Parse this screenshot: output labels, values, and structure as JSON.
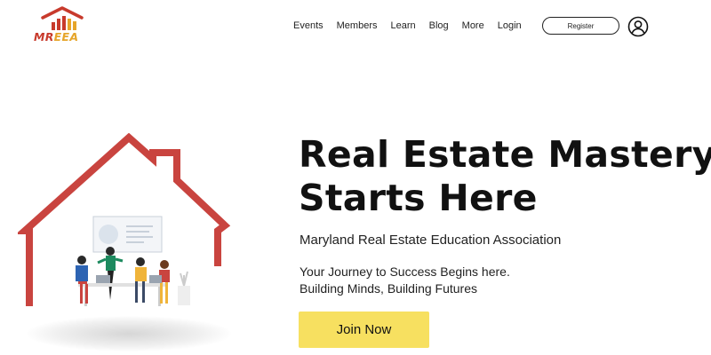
{
  "header": {
    "logo_part1": "MR",
    "logo_part2": "EEA",
    "nav": [
      {
        "label": "Events"
      },
      {
        "label": "Members"
      },
      {
        "label": "Learn"
      },
      {
        "label": "Blog"
      },
      {
        "label": "More"
      },
      {
        "label": "Login"
      }
    ],
    "register_label": "Register",
    "user_icon": "user-circle-icon"
  },
  "hero": {
    "title_line1": "Real Estate Mastery",
    "title_line2": "Starts Here",
    "org_name": "Maryland Real Estate Education Association",
    "tagline_line1": "Your Journey to Success Begins here.",
    "tagline_line2": "Building Minds, Building Futures",
    "cta_label": "Join Now"
  },
  "colors": {
    "logo_red": "#c83a2c",
    "logo_yellow": "#e6a52a",
    "house_outline": "#c9443f",
    "cta_background": "#f7e060"
  }
}
